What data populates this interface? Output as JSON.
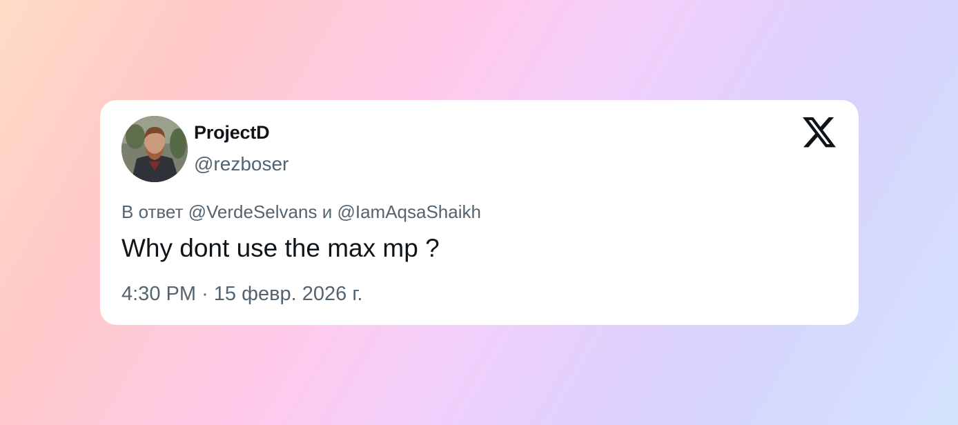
{
  "tweet": {
    "display_name": "ProjectD",
    "handle": "@rezboser",
    "reply_prefix": "В ответ",
    "reply_mention_1": "@VerdeSelvans",
    "reply_conjunction": "и",
    "reply_mention_2": "@IamAqsaShaikh",
    "text": "Why dont use the max mp ?",
    "time": "4:30 PM",
    "separator": "·",
    "date": "15 февр. 2026 г."
  },
  "icons": {
    "brand": "x-logo-icon",
    "avatar": "profile-photo"
  },
  "colors": {
    "card_background": "#ffffff",
    "primary_text": "#0f1419",
    "secondary_text": "#536471"
  }
}
